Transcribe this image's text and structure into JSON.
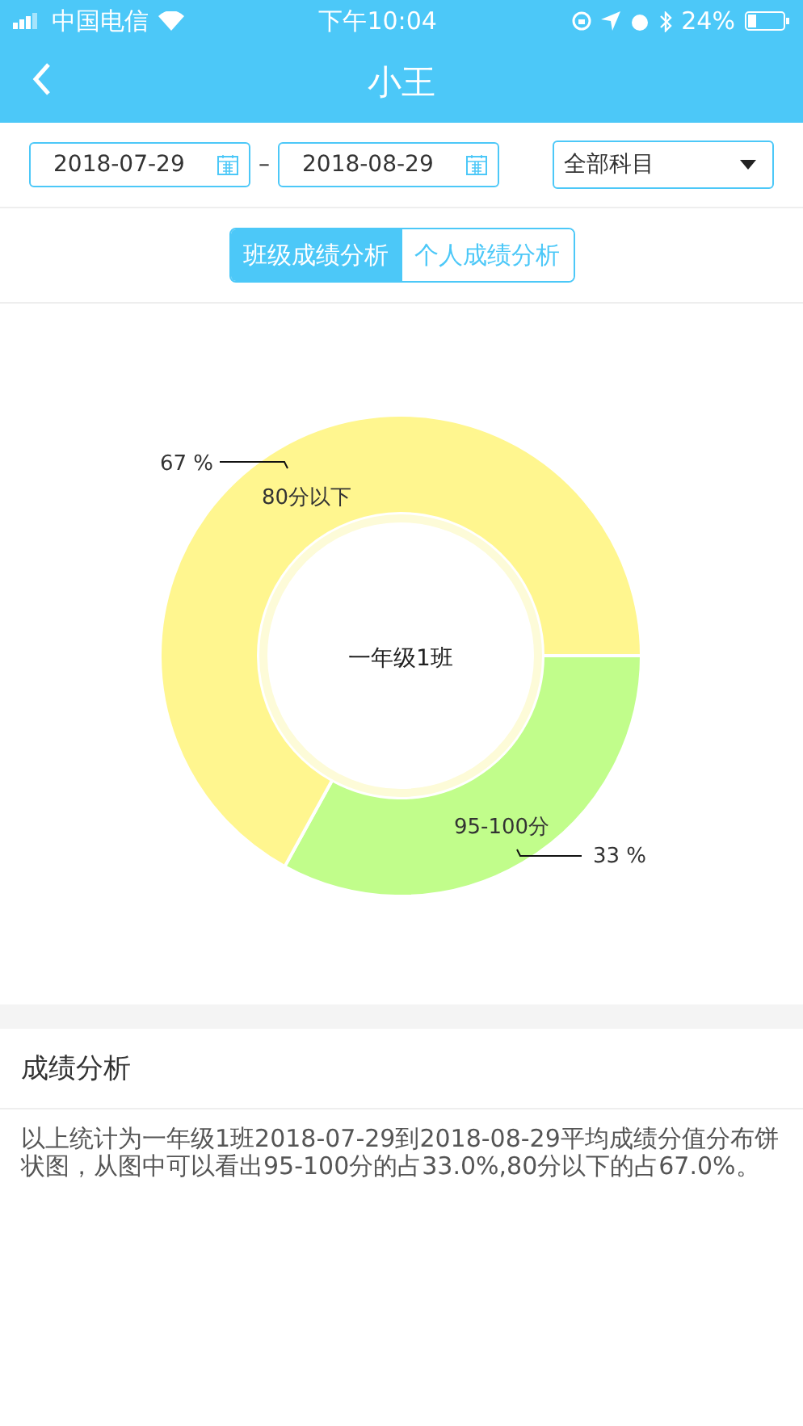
{
  "status_bar": {
    "carrier": "中国电信",
    "time": "下午10:04",
    "battery": "24%"
  },
  "nav": {
    "title": "小王"
  },
  "filters": {
    "start_date": "2018-07-29",
    "separator": "–",
    "end_date": "2018-08-29",
    "subject": "全部科目"
  },
  "tabs": [
    {
      "label": "班级成绩分析",
      "selected": true
    },
    {
      "label": "个人成绩分析",
      "selected": false
    }
  ],
  "chart": {
    "chart_data": {
      "type": "donut",
      "title": "一年级1班",
      "categories": [
        "80分以下",
        "95-100分"
      ],
      "series": [
        {
          "values": [
            67,
            33
          ]
        }
      ],
      "colors": [
        "#fff68f",
        "#c1fd8b"
      ],
      "value_labels": [
        "67 %",
        "33 %"
      ]
    }
  },
  "analysis": {
    "title": "成绩分析",
    "text": "以上统计为一年级1班2018-07-29到2018-08-29平均成绩分值分布饼状图，从图中可以看出95-100分的占33.0%,80分以下的占67.0%。"
  }
}
